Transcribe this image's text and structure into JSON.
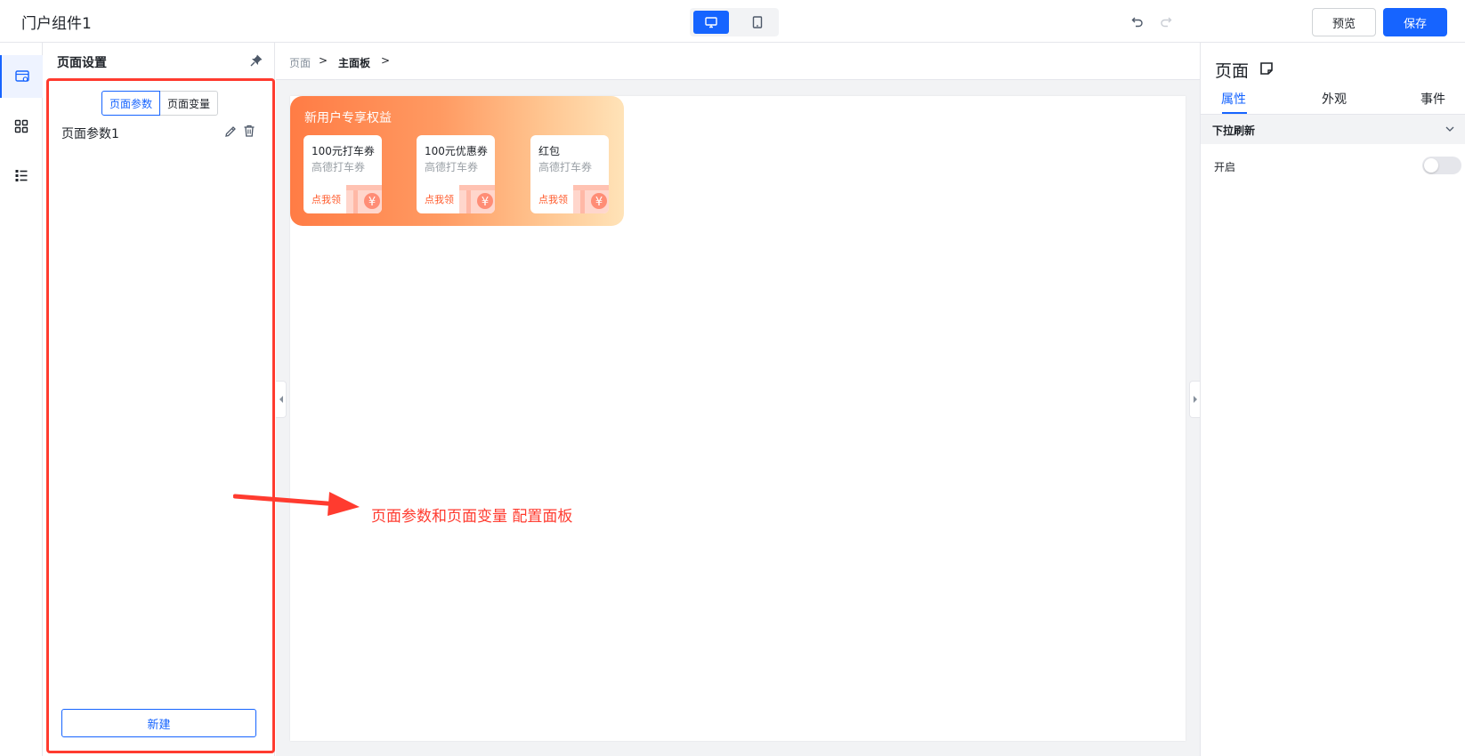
{
  "app": {
    "title": "门户组件1"
  },
  "toolbar": {
    "preview_label": "预览",
    "save_label": "保存"
  },
  "left_panel": {
    "title": "页面设置",
    "segments": [
      "页面参数",
      "页面变量"
    ],
    "active_segment": "页面参数",
    "params": [
      {
        "name": "页面参数1"
      }
    ],
    "new_button_label": "新建"
  },
  "breadcrumb": {
    "items": [
      "页面",
      "主面板"
    ],
    "separator": ">"
  },
  "canvas": {
    "banner_title": "新用户专享权益",
    "coupons": [
      {
        "name": "100元打车券",
        "sub": "高德打车券",
        "cta": "点我领"
      },
      {
        "name": "100元优惠券",
        "sub": "高德打车券",
        "cta": "点我领"
      },
      {
        "name": "红包",
        "sub": "高德打车券",
        "cta": "点我领"
      }
    ]
  },
  "annotation": {
    "text": "页面参数和页面变量 配置面板",
    "color": "#ff3b2f"
  },
  "right_panel": {
    "title": "页面",
    "tabs": [
      "属性",
      "外观",
      "事件"
    ],
    "active_tab": "属性",
    "section_label": "下拉刷新",
    "row_label": "开启",
    "toggle_on": false
  },
  "colors": {
    "accent": "#1664ff",
    "annotation": "#ff3b2f",
    "banner_start": "#ff7c45",
    "banner_end": "#ffe3b8"
  },
  "icons": [
    "desktop-icon",
    "tablet-icon",
    "undo-icon",
    "redo-icon",
    "page-settings-icon",
    "components-icon",
    "outline-icon",
    "pin-icon",
    "edit-icon",
    "trash-icon",
    "note-icon",
    "chevron-down-icon"
  ]
}
